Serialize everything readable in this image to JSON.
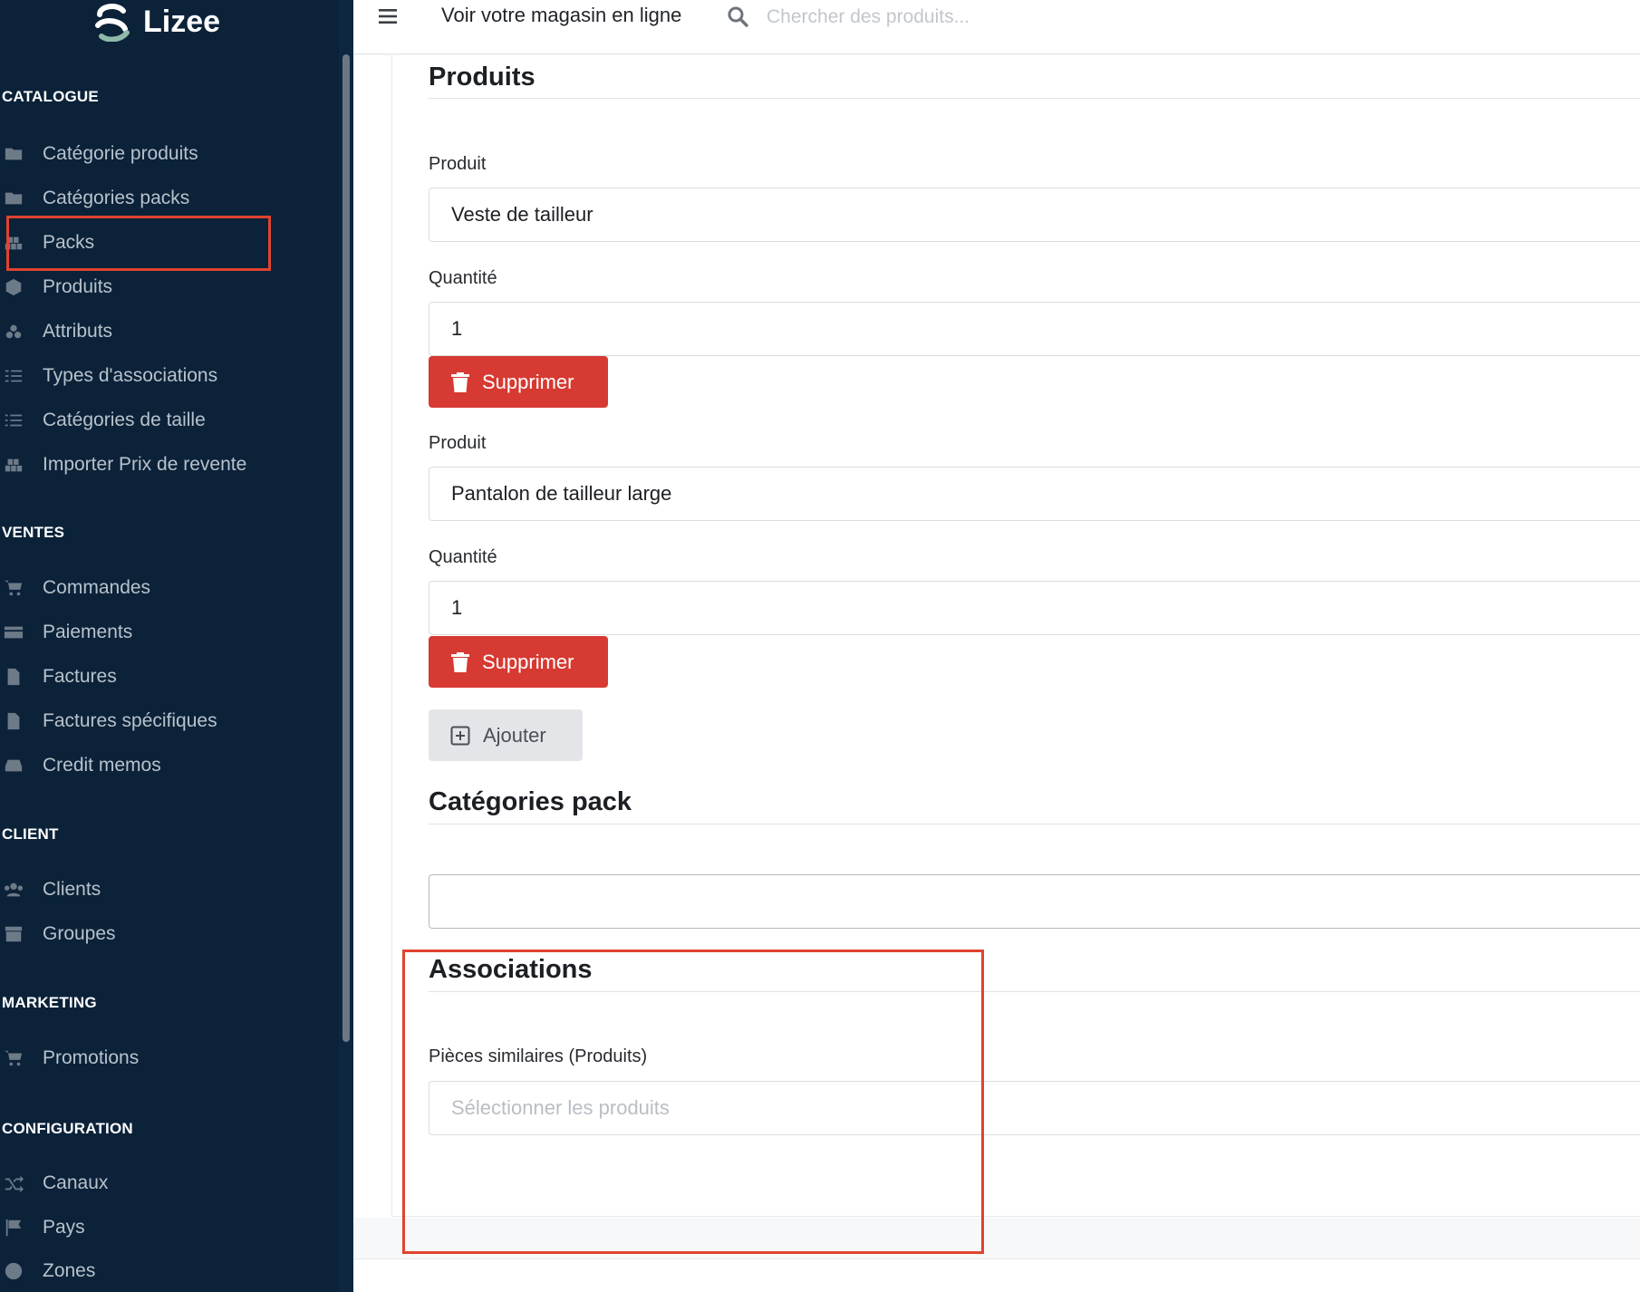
{
  "brand": {
    "name": "Lizee"
  },
  "topbar": {
    "store_link": "Voir votre magasin en ligne",
    "search_placeholder": "Chercher des produits..."
  },
  "sidebar": {
    "catalogue": {
      "title": "CATALOGUE",
      "items": [
        {
          "label": "Catégorie produits",
          "icon": "folder-icon"
        },
        {
          "label": "Catégories packs",
          "icon": "folder-icon"
        },
        {
          "label": "Packs",
          "icon": "cubes-icon"
        },
        {
          "label": "Produits",
          "icon": "cube-icon"
        },
        {
          "label": "Attributs",
          "icon": "cubes-outline-icon"
        },
        {
          "label": "Types d'associations",
          "icon": "tasks-icon"
        },
        {
          "label": "Catégories de taille",
          "icon": "list-icon"
        },
        {
          "label": "Importer Prix de revente",
          "icon": "cubes-icon"
        }
      ]
    },
    "ventes": {
      "title": "VENTES",
      "items": [
        {
          "label": "Commandes",
          "icon": "cart-icon"
        },
        {
          "label": "Paiements",
          "icon": "credit-card-icon"
        },
        {
          "label": "Factures",
          "icon": "file-icon"
        },
        {
          "label": "Factures spécifiques",
          "icon": "file-icon"
        },
        {
          "label": "Credit memos",
          "icon": "inbox-icon"
        }
      ]
    },
    "client": {
      "title": "CLIENT",
      "items": [
        {
          "label": "Clients",
          "icon": "users-icon"
        },
        {
          "label": "Groupes",
          "icon": "archive-icon"
        }
      ]
    },
    "marketing": {
      "title": "MARKETING",
      "items": [
        {
          "label": "Promotions",
          "icon": "cart-plus-icon"
        }
      ]
    },
    "configuration": {
      "title": "CONFIGURATION",
      "items": [
        {
          "label": "Canaux",
          "icon": "shuffle-icon"
        },
        {
          "label": "Pays",
          "icon": "flag-icon"
        },
        {
          "label": "Zones",
          "icon": "globe-icon"
        }
      ]
    }
  },
  "main": {
    "products_section": {
      "title": "Produits",
      "entries": [
        {
          "product_label": "Produit",
          "product_value": "Veste de tailleur",
          "qty_label": "Quantité",
          "qty_value": "1",
          "delete_label": "Supprimer"
        },
        {
          "product_label": "Produit",
          "product_value": "Pantalon de tailleur large",
          "qty_label": "Quantité",
          "qty_value": "1",
          "delete_label": "Supprimer"
        }
      ],
      "add_label": "Ajouter"
    },
    "pack_categories": {
      "title": "Catégories pack",
      "value": ""
    },
    "associations": {
      "title": "Associations",
      "similar_label": "Pièces similaires (Produits)",
      "similar_placeholder": "Sélectionner les produits"
    }
  },
  "colors": {
    "sidebar_bg": "#0b2239",
    "danger": "#d63a32",
    "highlight": "#e0432f"
  }
}
